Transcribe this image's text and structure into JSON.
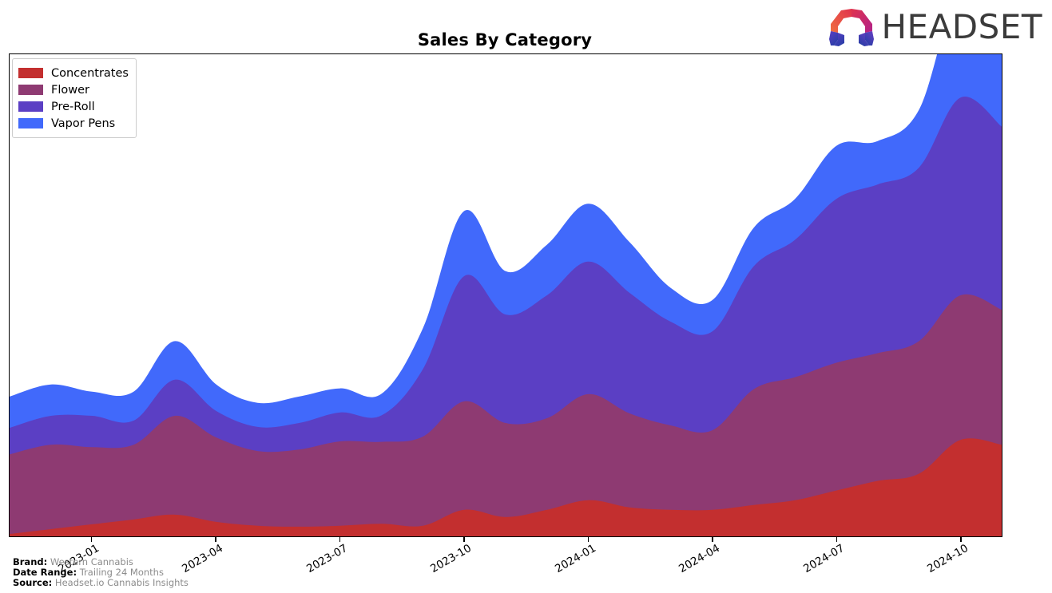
{
  "header": {
    "title": "Sales By Category",
    "brand_name": "HEADSET",
    "logo_icon": "headset-hexagon-logo"
  },
  "legend": {
    "position": "upper-left",
    "items": [
      {
        "label": "Concentrates",
        "color": "#C32F2F"
      },
      {
        "label": "Flower",
        "color": "#8E3A72"
      },
      {
        "label": "Pre-Roll",
        "color": "#5B3FC4"
      },
      {
        "label": "Vapor Pens",
        "color": "#4169FB"
      }
    ]
  },
  "footer": {
    "brand_key": "Brand:",
    "brand_value": "Western Cannabis",
    "date_range_key": "Date Range:",
    "date_range_value": "Trailing 24 Months",
    "source_key": "Source:",
    "source_value": "Headset.io Cannabis Insights"
  },
  "chart_data": {
    "type": "area",
    "stacked": true,
    "title": "Sales By Category",
    "xlabel": "",
    "ylabel": "",
    "grid": false,
    "legend_position": "upper left",
    "axis_ticks_visible": {
      "x": true,
      "y": false
    },
    "x": [
      "2022-11",
      "2022-12",
      "2023-01",
      "2023-02",
      "2023-03",
      "2023-04",
      "2023-05",
      "2023-06",
      "2023-07",
      "2023-08",
      "2023-09",
      "2023-10",
      "2023-11",
      "2023-12",
      "2024-01",
      "2024-02",
      "2024-03",
      "2024-04",
      "2024-05",
      "2024-06",
      "2024-07",
      "2024-08",
      "2024-09",
      "2024-10",
      "2024-11"
    ],
    "tick_labels": [
      "2023-01",
      "2023-04",
      "2023-07",
      "2023-10",
      "2024-01",
      "2024-04",
      "2024-07",
      "2024-10"
    ],
    "ylim": [
      0,
      100
    ],
    "series": [
      {
        "name": "Concentrates",
        "color": "#C32F2F",
        "values": [
          0.5,
          1.5,
          2.5,
          3.5,
          4.5,
          3.0,
          2.2,
          2.0,
          2.2,
          2.6,
          2.2,
          5.5,
          4.0,
          5.5,
          7.5,
          6.0,
          5.5,
          5.5,
          6.5,
          7.5,
          9.5,
          11.5,
          13.0,
          20.0,
          19.0
        ]
      },
      {
        "name": "Flower",
        "color": "#8E3A72",
        "values": [
          16.5,
          17.5,
          16.0,
          15.5,
          20.5,
          17.5,
          15.5,
          16.0,
          17.5,
          17.0,
          18.5,
          22.5,
          19.5,
          19.0,
          22.0,
          19.5,
          17.5,
          16.5,
          24.0,
          25.5,
          26.5,
          26.5,
          27.5,
          30.0,
          28.0
        ]
      },
      {
        "name": "Pre-Roll",
        "color": "#5B3FC4",
        "values": [
          5.5,
          6.0,
          6.5,
          5.0,
          7.5,
          5.5,
          5.0,
          5.5,
          6.0,
          5.5,
          14.0,
          26.0,
          22.5,
          25.5,
          27.5,
          25.0,
          21.5,
          20.5,
          25.5,
          28.5,
          34.0,
          35.0,
          36.0,
          41.0,
          38.0
        ]
      },
      {
        "name": "Vapor Pens",
        "color": "#4169FB",
        "values": [
          6.5,
          6.5,
          5.0,
          6.0,
          8.0,
          5.5,
          5.0,
          5.5,
          5.0,
          4.5,
          8.5,
          13.5,
          9.0,
          10.5,
          12.0,
          10.5,
          7.0,
          6.5,
          8.0,
          8.5,
          11.0,
          9.0,
          12.0,
          22.5,
          19.0
        ]
      }
    ]
  }
}
